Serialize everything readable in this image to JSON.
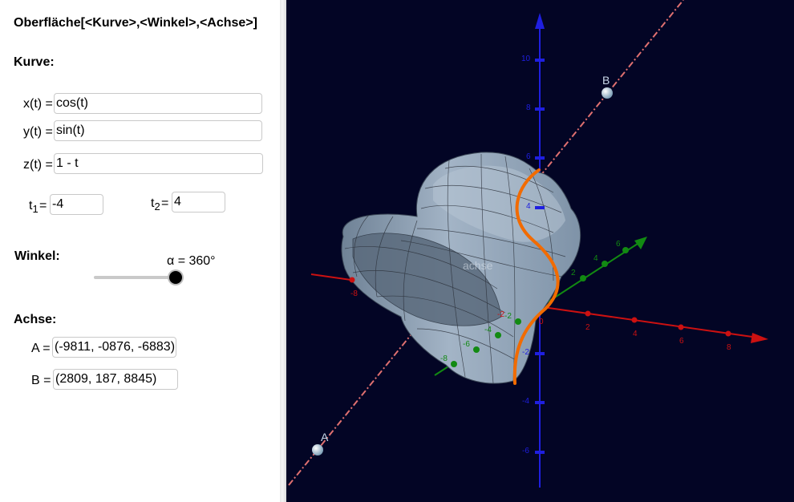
{
  "command_title": "Oberfläche[<Kurve>,<Winkel>,<Achse>]",
  "kurve": {
    "heading": "Kurve:",
    "x_label": "x(t) =",
    "x_value": "cos(t)",
    "y_label": "y(t) =",
    "y_value": "sin(t)",
    "z_label": "z(t) =",
    "z_value": "1 - t",
    "t1_label": "t",
    "t1_sub": "1",
    "t1_eq": "=",
    "t1_value": "-4",
    "t2_label": "t",
    "t2_sub": "2",
    "t2_eq": "=",
    "t2_value": "4"
  },
  "winkel": {
    "heading": "Winkel:",
    "slider_label": "α = 360°",
    "value_deg": 360,
    "max_deg": 360
  },
  "achse": {
    "heading": "Achse:",
    "a_label": "A =",
    "a_value": "(-9811, -0876, -6883)",
    "b_label": "B =",
    "b_value": "(2809, 187, 8845)"
  },
  "graphics": {
    "point_a_label": "A",
    "point_b_label": "B",
    "surface_label": "achse",
    "x_ticks": [
      "-8",
      "-2",
      "2",
      "4",
      "6",
      "8"
    ],
    "y_ticks": [
      "-8",
      "-6",
      "-4",
      "-2",
      "2",
      "4",
      "6",
      "8"
    ],
    "z_ticks": [
      "10",
      "8",
      "6",
      "4",
      "-2",
      "-4",
      "-6"
    ],
    "origin_label": "0",
    "colors": {
      "background": "#030525",
      "x_axis": "#cc1111",
      "y_axis": "#128a12",
      "z_axis": "#1f1fe0",
      "axis_line": "#e07070",
      "curve": "#f26b00",
      "surface": "#8a9db2"
    }
  }
}
